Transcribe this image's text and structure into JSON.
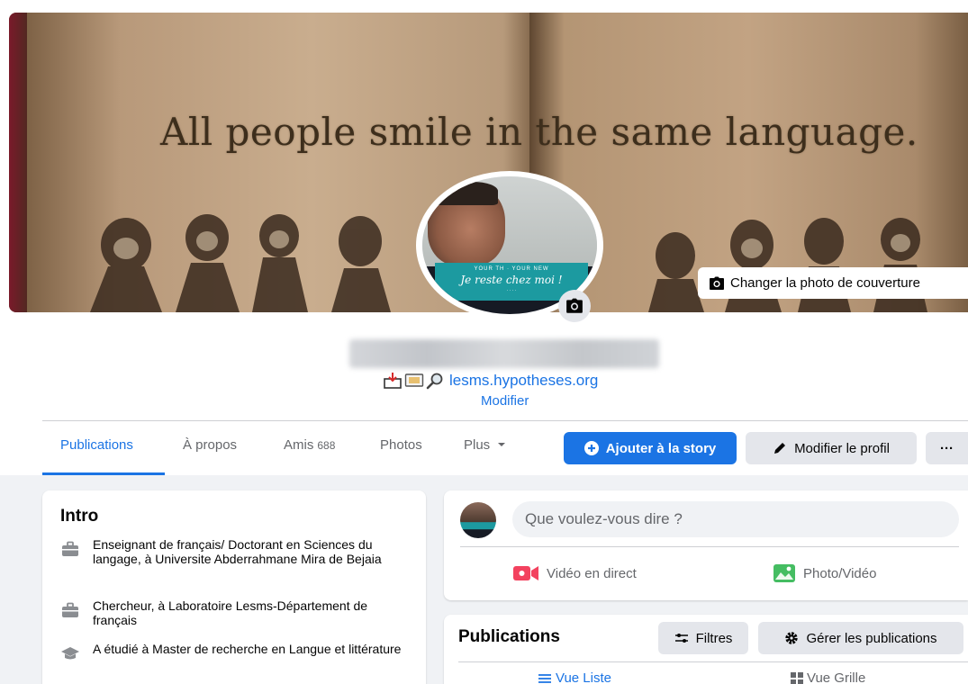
{
  "cover": {
    "quote": "All people smile in the same language.",
    "change_cover_label": "Changer la photo de couverture"
  },
  "avatar": {
    "banner_line1": "YOUR TH · YOUR NEW",
    "banner_line2": "Je reste chez moi !",
    "banner_line3": "· · · ·"
  },
  "profile": {
    "website": "lesms.hypotheses.org",
    "edit_label": "Modifier"
  },
  "tabs": [
    {
      "label": "Publications",
      "active": true
    },
    {
      "label": "À propos"
    },
    {
      "label": "Amis",
      "count": "688"
    },
    {
      "label": "Photos"
    },
    {
      "label": "Plus"
    }
  ],
  "actions": {
    "add_story": "Ajouter à la story",
    "edit_profile": "Modifier le profil",
    "more": "···"
  },
  "intro": {
    "title": "Intro",
    "items": [
      {
        "icon": "briefcase-icon",
        "text": "Enseignant de français/ Doctorant en Sciences du langage, à Universite Abderrahmane Mira de Bejaia"
      },
      {
        "icon": "briefcase-icon",
        "text": "Chercheur, à Laboratoire Lesms-Département de français"
      },
      {
        "icon": "graduation-cap-icon",
        "text": "A étudié à Master de recherche en Langue et littérature"
      }
    ]
  },
  "composer": {
    "placeholder": "Que voulez-vous dire ?",
    "live_video": "Vidéo en direct",
    "photo_video": "Photo/Vidéo"
  },
  "publications": {
    "title": "Publications",
    "filters": "Filtres",
    "manage": "Gérer les publications",
    "list_view": "Vue Liste",
    "grid_view": "Vue Grille"
  },
  "colors": {
    "accent": "#1b74e4",
    "background": "#f0f2f5",
    "button_gray": "#e4e6eb",
    "live_red": "#f3425f",
    "photo_green": "#45bd62"
  }
}
